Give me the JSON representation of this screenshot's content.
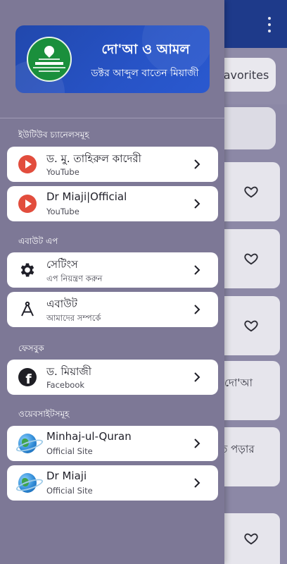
{
  "background": {
    "favorites_label": "Favorites",
    "card_text_1": "র দো'আ",
    "card_text_2": "তে পড়ার"
  },
  "banner": {
    "title": "দো'আ ও আমল",
    "subtitle": "ডক্টর আব্দুল বাতেন মিয়াজী"
  },
  "sections": {
    "youtube": {
      "title": "ইউটিউব চ্যানেলসমূহ",
      "items": [
        {
          "title": "ড. মু. তাহিরুল কাদেরী",
          "subtitle": "YouTube"
        },
        {
          "title": "Dr Miaji|Official",
          "subtitle": "YouTube"
        }
      ]
    },
    "about_app": {
      "title": "এবাউট এপ",
      "items": [
        {
          "title": "সেটিংস",
          "subtitle": "এপ নিয়ন্ত্রণ করুন"
        },
        {
          "title": "এবাউট",
          "subtitle": "আমাদের সম্পর্কে"
        }
      ]
    },
    "facebook": {
      "title": "ফেসবুক",
      "items": [
        {
          "title": "ড. মিয়াজী",
          "subtitle": "Facebook"
        }
      ]
    },
    "websites": {
      "title": "ওয়েবসাইটসমূহ",
      "items": [
        {
          "title": "Minhaj-ul-Quran",
          "subtitle": "Official Site"
        },
        {
          "title": "Dr Miaji",
          "subtitle": "Official Site"
        }
      ]
    }
  },
  "colors": {
    "top_bar": "#1e3a8a",
    "banner": "#2753c6",
    "drawer": "#7d7896",
    "youtube_icon": "#e24d3d",
    "card": "#ffffff"
  }
}
